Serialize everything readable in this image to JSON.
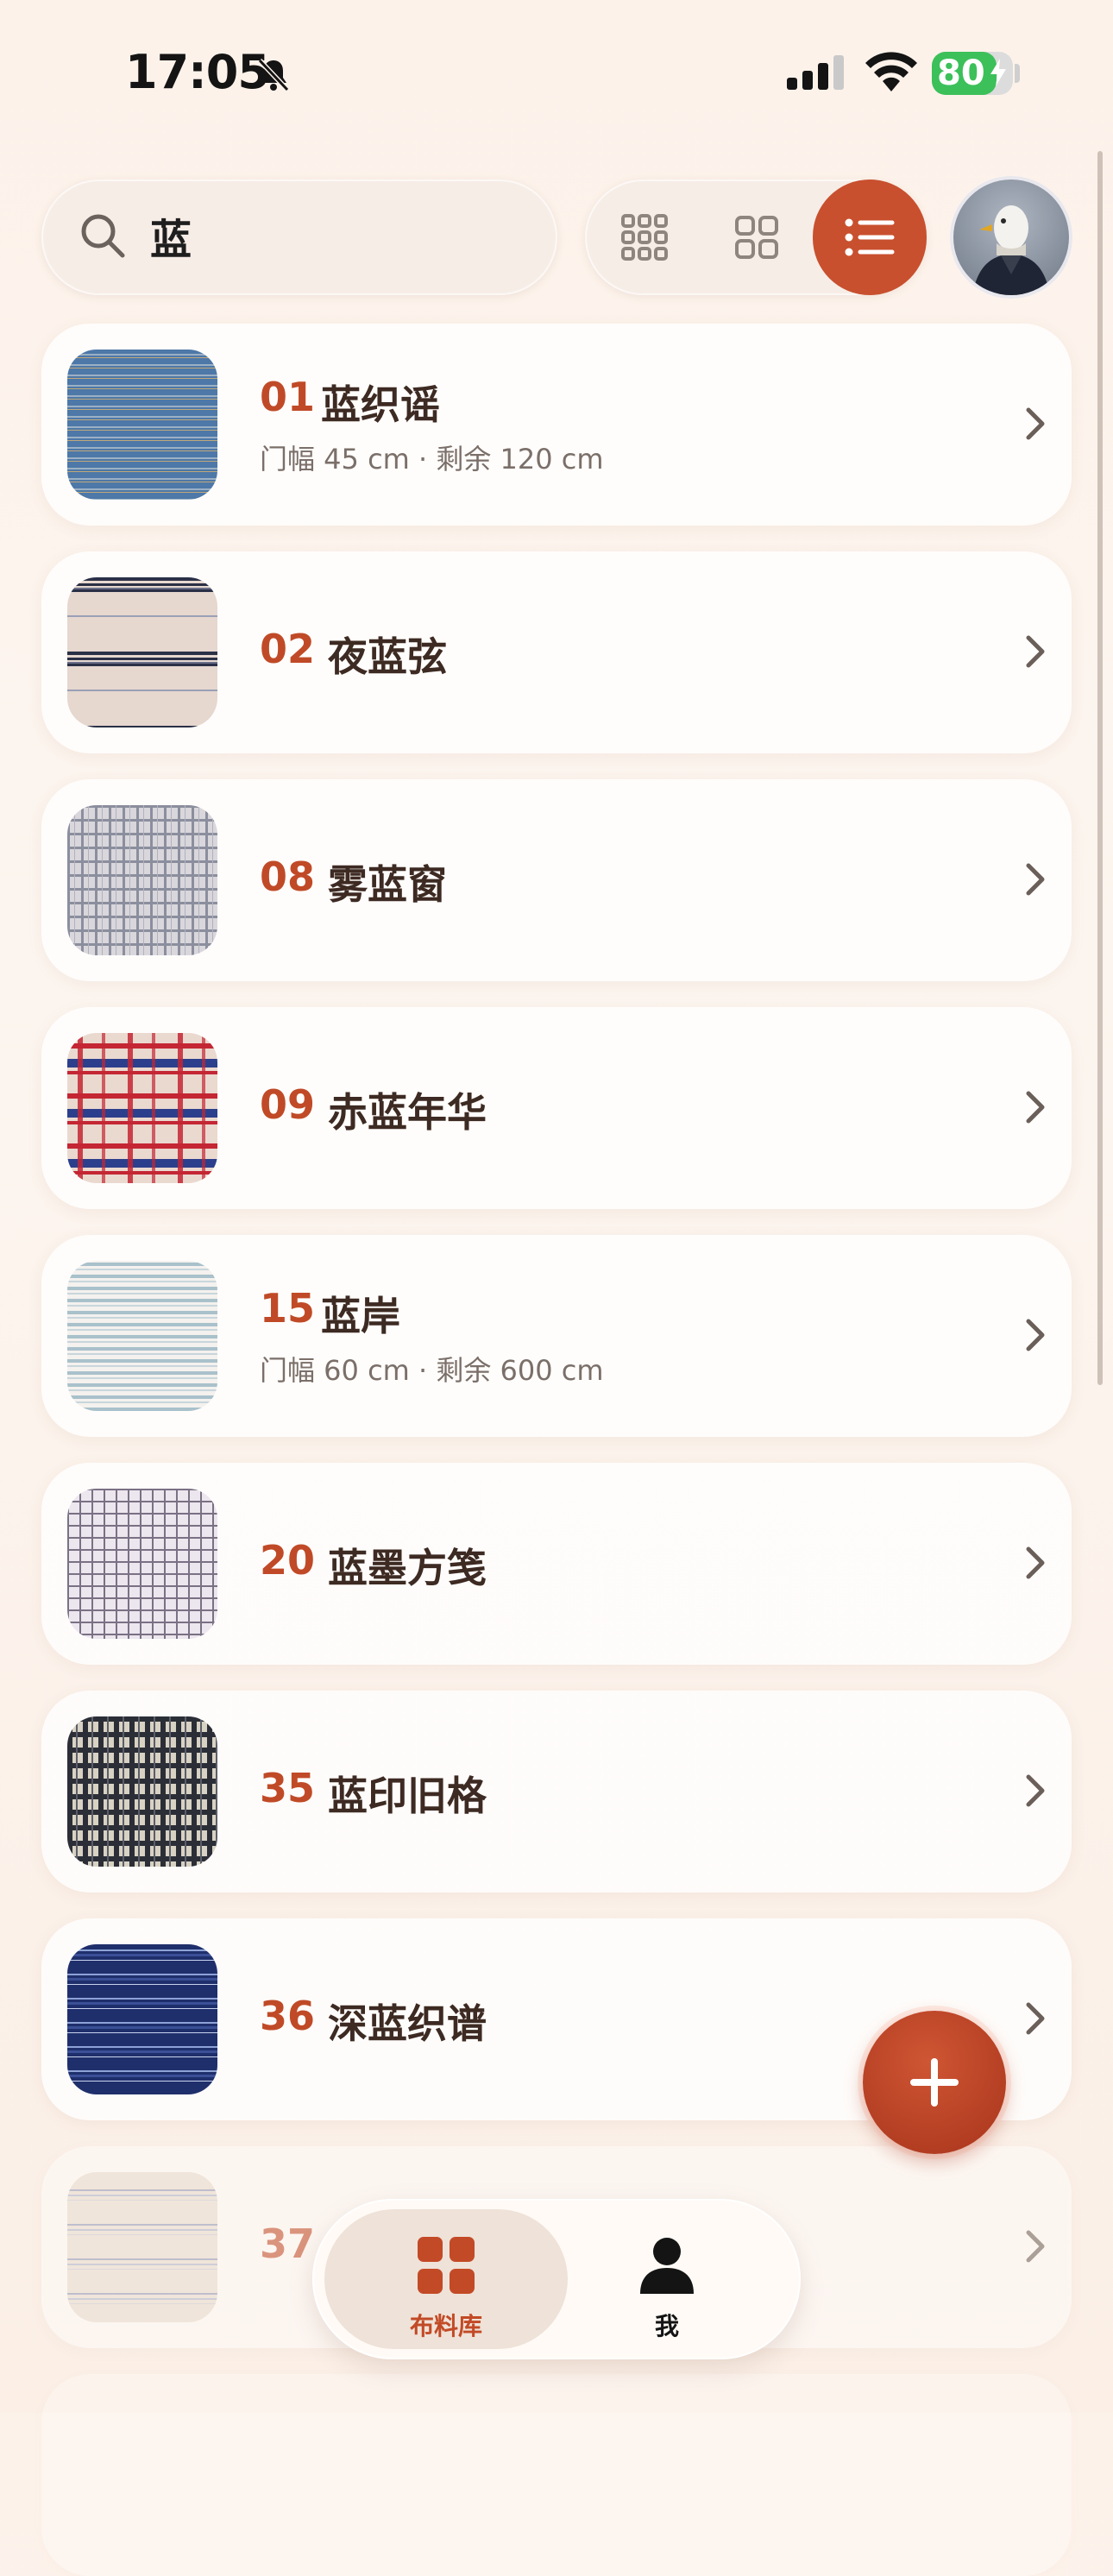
{
  "status": {
    "time": "17:05",
    "battery": "80",
    "battery_level": 0.8
  },
  "search": {
    "value": "蓝",
    "placeholder": ""
  },
  "view_modes": [
    "grid-small",
    "grid-large",
    "list"
  ],
  "active_view": "list",
  "accent_color": "#c8502e",
  "items": [
    {
      "num": "01",
      "name": "蓝织谣",
      "sub": "门幅 45 cm · 剩余 120 cm"
    },
    {
      "num": "02",
      "name": "夜蓝弦",
      "sub": ""
    },
    {
      "num": "08",
      "name": "雾蓝窗",
      "sub": ""
    },
    {
      "num": "09",
      "name": "赤蓝年华",
      "sub": ""
    },
    {
      "num": "15",
      "name": "蓝岸",
      "sub": "门幅 60 cm · 剩余 600 cm"
    },
    {
      "num": "20",
      "name": "蓝墨方笺",
      "sub": ""
    },
    {
      "num": "35",
      "name": "蓝印旧格",
      "sub": ""
    },
    {
      "num": "36",
      "name": "深蓝织谱",
      "sub": ""
    },
    {
      "num": "37",
      "name": "",
      "sub": ""
    }
  ],
  "tabs": [
    {
      "label": "布料库",
      "icon": "grid-icon"
    },
    {
      "label": "我",
      "icon": "person-icon"
    }
  ]
}
